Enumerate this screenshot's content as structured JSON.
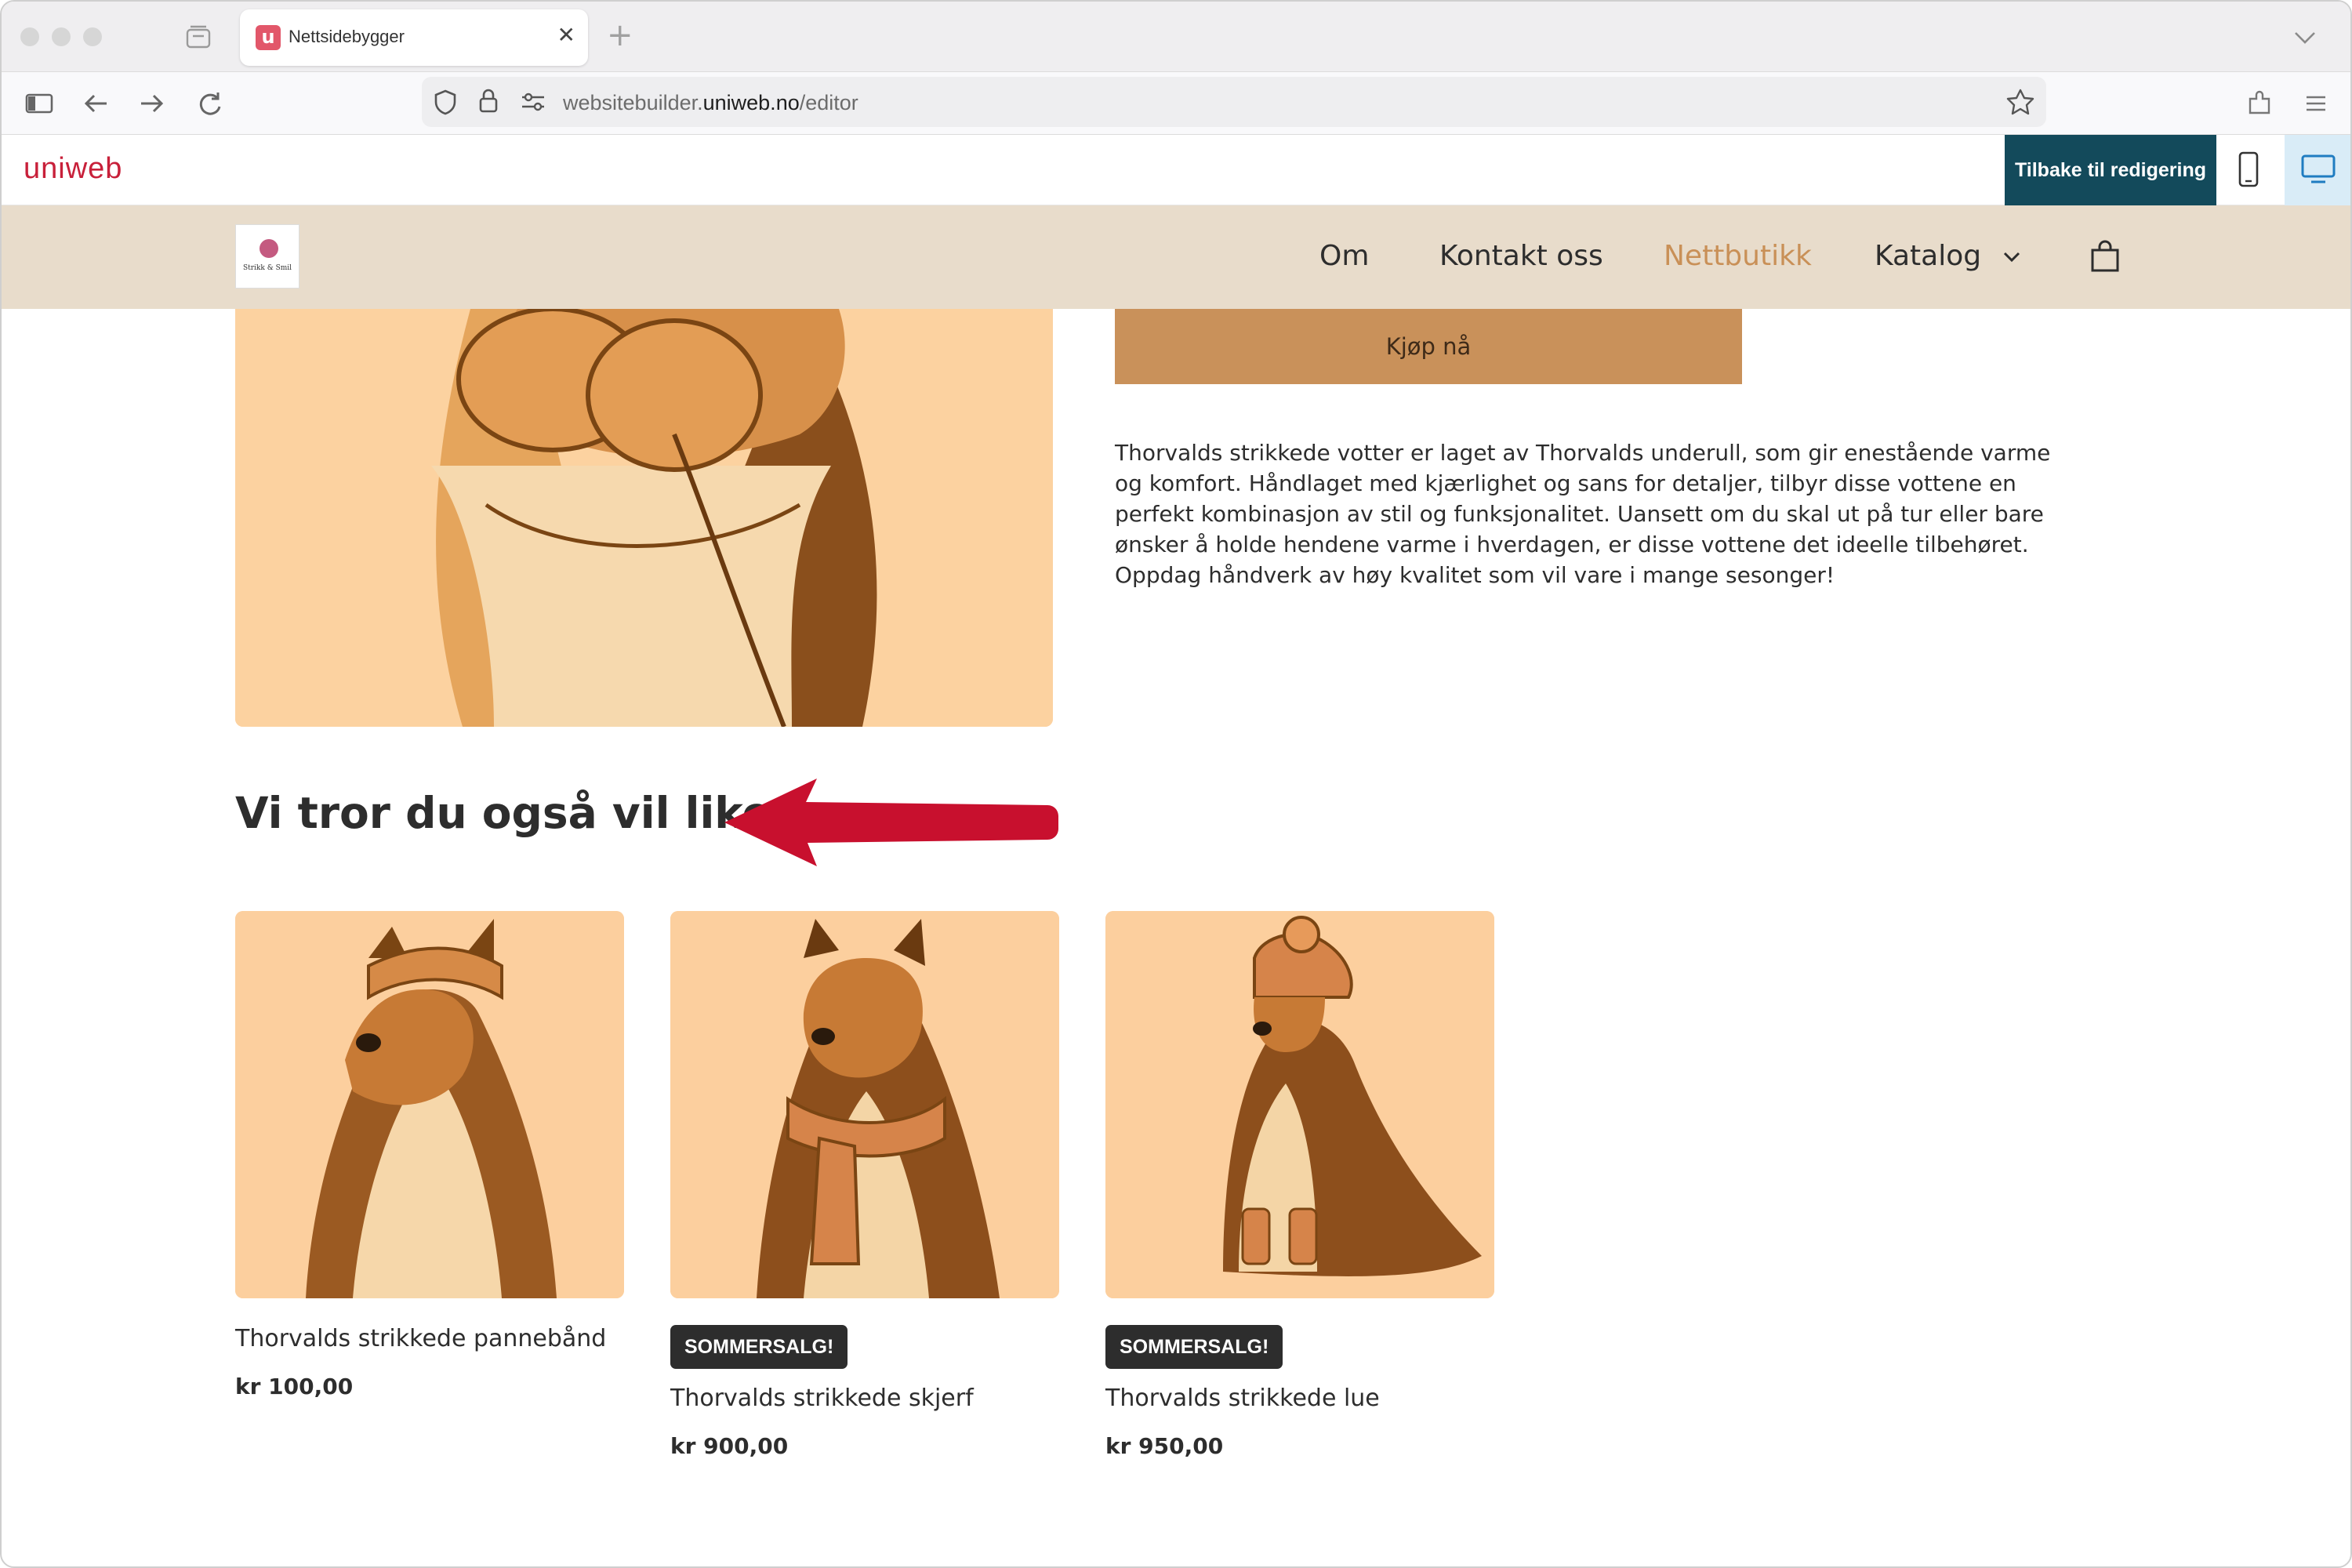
{
  "browser": {
    "tab": {
      "favicon": "u",
      "title": "Nettsidebygger"
    },
    "url": {
      "prefix": "websitebuilder.",
      "domain": "uniweb.no",
      "path": "/editor"
    },
    "icons": [
      "sidebar-icon",
      "back-icon",
      "forward-icon",
      "reload-icon",
      "shield-icon",
      "lock-icon",
      "site-settings-icon",
      "bookmark-star-icon",
      "extensions-icon",
      "menu-icon"
    ]
  },
  "editor": {
    "logo": "uniweb",
    "back_to_edit": "Tilbake til redigering",
    "device_modes": [
      "mobile-icon",
      "desktop-icon"
    ],
    "active_device": "desktop",
    "colors": {
      "accent": "#134a5b",
      "brand": "#c8203a"
    }
  },
  "site": {
    "logo_text": "Strikk & Smil",
    "menu": [
      {
        "label": "Om",
        "active": false
      },
      {
        "label": "Kontakt oss",
        "active": false
      },
      {
        "label": "Nettbutikk",
        "active": true
      },
      {
        "label": "Katalog",
        "active": false
      }
    ],
    "colors": {
      "header_bg": "#e8dccb",
      "active_link": "#c99057",
      "button": "#c9915a"
    }
  },
  "product": {
    "buy_label": "Kjøp nå",
    "description": "Thorvalds strikkede votter er laget av Thorvalds underull, som gir enestående varme og komfort. Håndlaget med kjærlighet og sans for detaljer, tilbyr disse vottene en perfekt kombinasjon av stil og funksjonalitet. Uansett om du skal ut på tur eller bare ønsker å holde hendene varme i hverdagen, er disse vottene det ideelle tilbehøret. Oppdag håndverk av høy kvalitet som vil vare i mange sesonger!"
  },
  "related": {
    "title": "Vi tror du også vil like",
    "items": [
      {
        "name": "Thorvalds strikkede pannebånd",
        "price": "kr 100,00",
        "badge": ""
      },
      {
        "name": "Thorvalds strikkede skjerf",
        "price": "kr 900,00",
        "badge": "SOMMERSALG!"
      },
      {
        "name": "Thorvalds strikkede lue",
        "price": "kr 950,00",
        "badge": "SOMMERSALG!"
      }
    ]
  }
}
